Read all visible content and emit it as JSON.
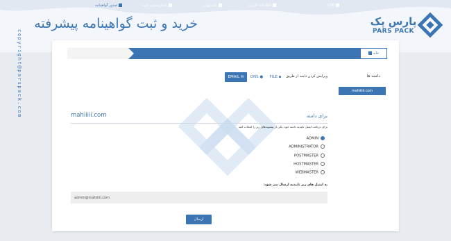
{
  "page": {
    "title": "خرید و ثبت گواهینامه پیشرفته",
    "side_note": "copyright@parspack.com"
  },
  "brand": {
    "name": "پارس پک",
    "sub": "PARS PACK",
    "color": "#3c75b4"
  },
  "steps": {
    "home": "خانه",
    "items": [
      {
        "label": "CSR",
        "icon": "doc-icon"
      },
      {
        "label": "اطلاعات کاربری",
        "icon": "user-icon"
      },
      {
        "label": "تایید نهایی",
        "icon": "check-icon"
      },
      {
        "label": "اعتبارسنجی دامنه",
        "icon": "search-icon"
      },
      {
        "label": "صدور گواهینامه",
        "icon": "certificate-icon"
      }
    ]
  },
  "sidebar": {
    "label": "دامنه ها",
    "domain": "mahiiiiii.com"
  },
  "validation": {
    "method_label": "ویرایش کردن دامنه از طریق",
    "tabs": {
      "file": "FILE",
      "dns": "DNS",
      "email": "EMAIL"
    },
    "for_domain": "برای دامنه",
    "domain": "mahiiiii.com",
    "instruction": "برای دریافت ایمیل تاییدیه دامنه خود، یکی از پیشوندهای زیر را انتخاب کنید",
    "options": [
      "ADMIN",
      "ADMINISTRATOR",
      "POSTMASTER",
      "HOSTMASTER",
      "WEBMASTER"
    ],
    "selected": "ADMIN",
    "confirm_label": "به ایمیل های زیر تاییدیه ارسال می شود:",
    "email_value": "admin@mahiiiii.com",
    "send": "ارسال"
  }
}
